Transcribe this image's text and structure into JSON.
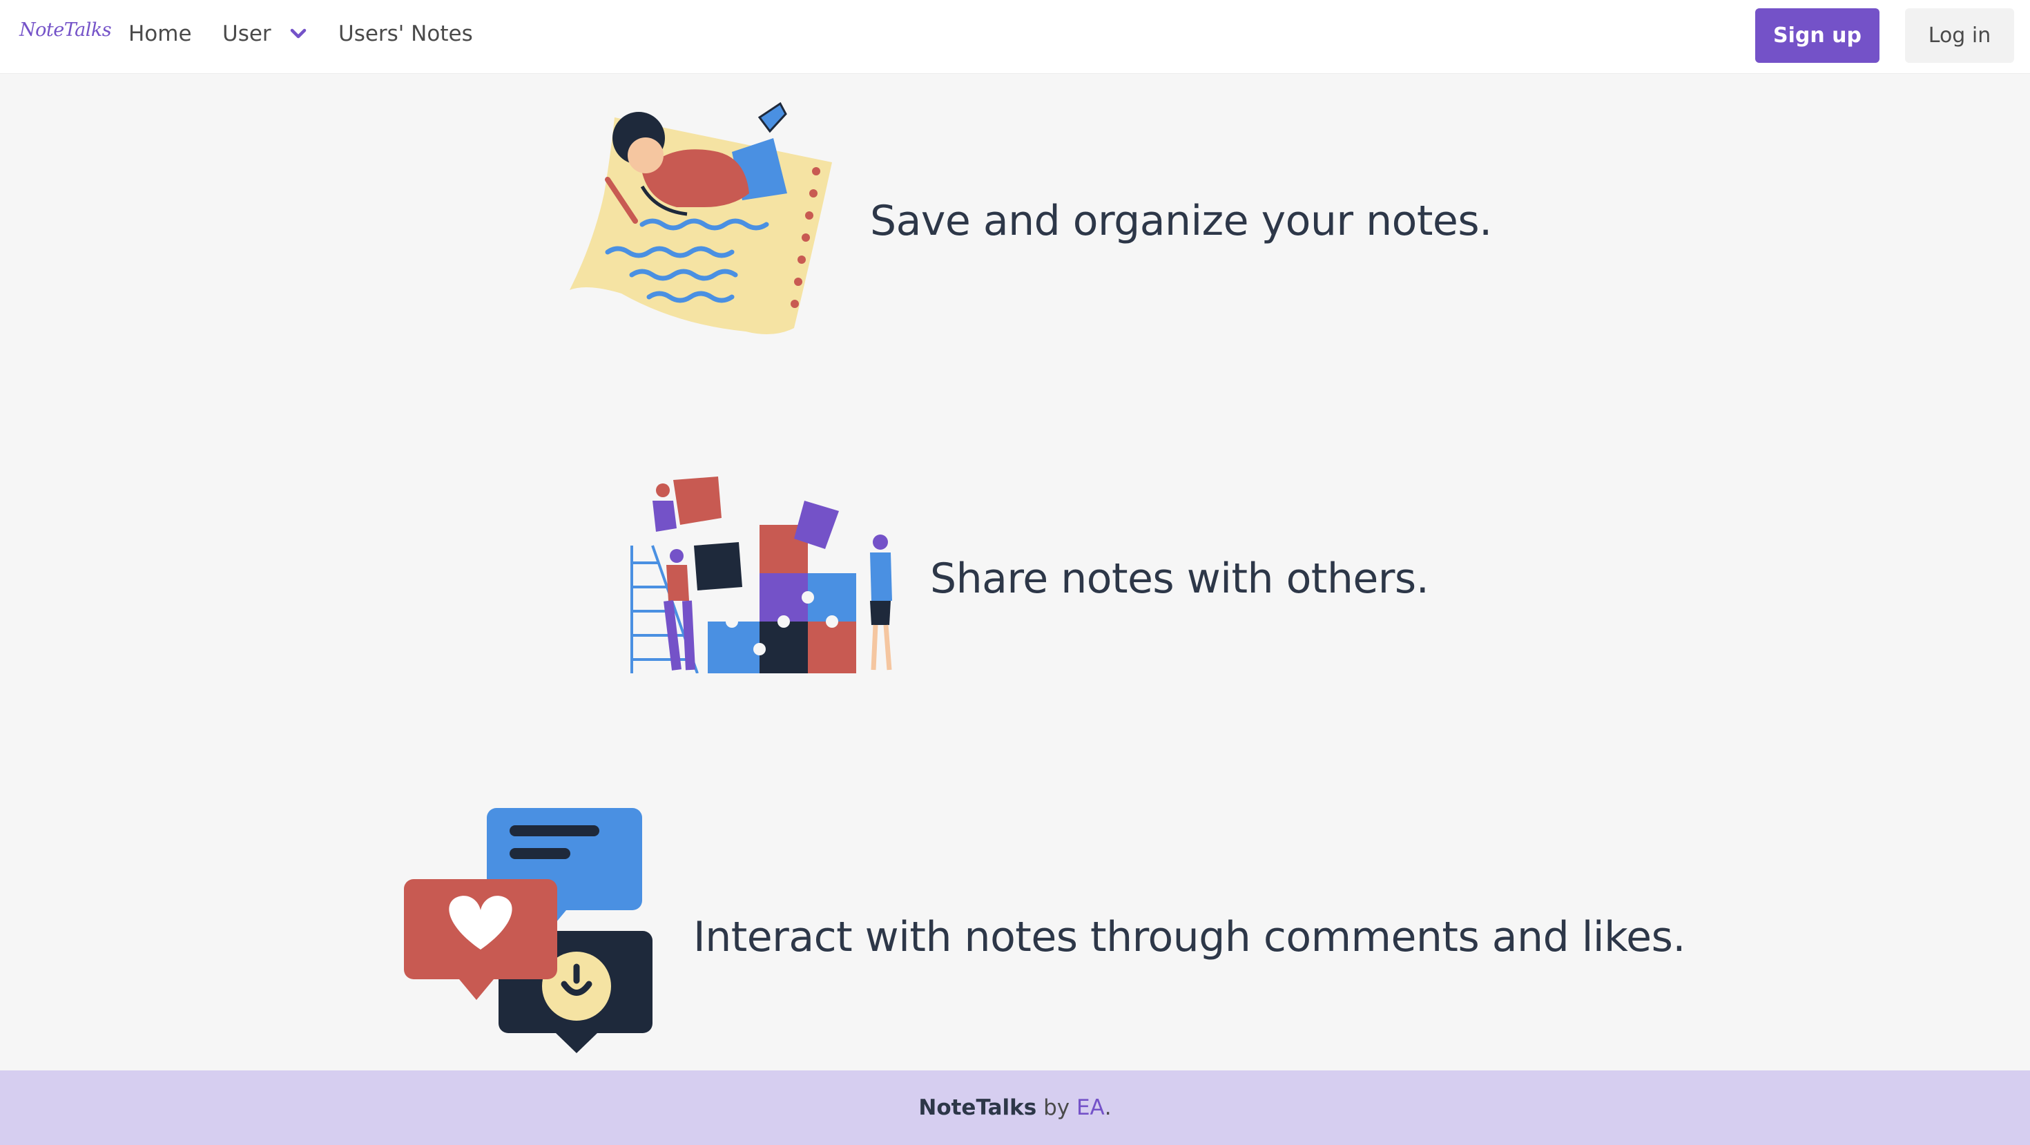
{
  "navbar": {
    "brand": "NoteTalks",
    "links": {
      "home": "Home",
      "user": "User",
      "users_notes": "Users' Notes"
    },
    "signup_label": "Sign up",
    "login_label": "Log in"
  },
  "features": [
    {
      "text": "Save and organize your notes.",
      "icon": "person-writing-notes-illustration"
    },
    {
      "text": "Share notes with others.",
      "icon": "people-assembling-puzzle-illustration"
    },
    {
      "text": "Interact with notes through comments and likes.",
      "icon": "chat-bubbles-heart-smile-illustration"
    }
  ],
  "footer": {
    "brand": "NoteTalks",
    "by": " by ",
    "author": "EA",
    "period": "."
  },
  "colors": {
    "accent": "#7452c8",
    "footer_bg": "#d6cef0",
    "page_bg": "#f6f6f6",
    "illustration_red": "#c85a52",
    "illustration_blue": "#4a90e2",
    "illustration_navy": "#1e293b",
    "illustration_yellow": "#f5e3a3"
  }
}
